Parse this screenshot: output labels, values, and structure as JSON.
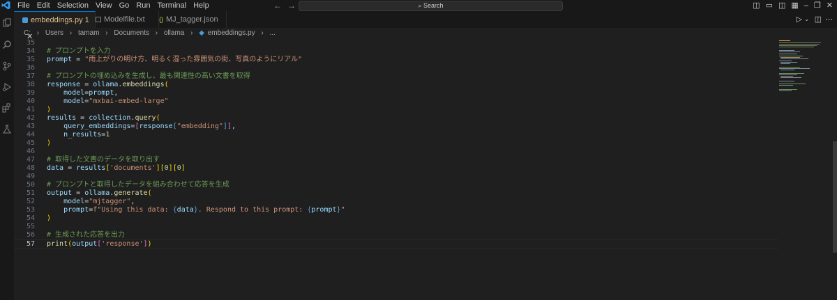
{
  "menu": [
    "File",
    "Edit",
    "Selection",
    "View",
    "Go",
    "Run",
    "Terminal",
    "Help"
  ],
  "search": {
    "label": "Search"
  },
  "tabs": [
    {
      "label": "embeddings.py 1",
      "icon": "python-icon"
    },
    {
      "label": "Modelfile.txt",
      "icon": "text-file-icon"
    },
    {
      "label": "MJ_tagger.json",
      "icon": "json-icon"
    }
  ],
  "breadcrumb": [
    "C:",
    "Users",
    "tamam",
    "Documents",
    "ollama",
    "embeddings.py",
    "..."
  ],
  "editor": {
    "lines": [
      {
        "n": "35",
        "parts": []
      },
      {
        "n": "34",
        "parts": [
          {
            "t": "# プロンプトを入力",
            "c": "c"
          }
        ]
      },
      {
        "n": "35",
        "parts": [
          {
            "t": "prompt",
            "c": "v"
          },
          {
            "t": " = ",
            "c": "o"
          },
          {
            "t": "\"雨上がりの明け方、明るく湿った雰囲気の街、写真のようにリアル\"",
            "c": "s"
          }
        ]
      },
      {
        "n": "36",
        "parts": []
      },
      {
        "n": "37",
        "parts": [
          {
            "t": "# プロンプトの埋め込みを生成し、最も関連性の高い文書を取得",
            "c": "c"
          }
        ]
      },
      {
        "n": "38",
        "parts": [
          {
            "t": "response",
            "c": "v"
          },
          {
            "t": " = ",
            "c": "o"
          },
          {
            "t": "ollama",
            "c": "v"
          },
          {
            "t": ".",
            "c": "o"
          },
          {
            "t": "embeddings",
            "c": "f"
          },
          {
            "t": "(",
            "c": "p"
          }
        ]
      },
      {
        "n": "39",
        "parts": [
          {
            "t": "    model",
            "c": "v"
          },
          {
            "t": "=",
            "c": "o"
          },
          {
            "t": "prompt",
            "c": "v"
          },
          {
            "t": ",",
            "c": "o"
          }
        ]
      },
      {
        "n": "40",
        "parts": [
          {
            "t": "    model",
            "c": "v"
          },
          {
            "t": "=",
            "c": "o"
          },
          {
            "t": "\"mxbai-embed-large\"",
            "c": "s"
          }
        ]
      },
      {
        "n": "41",
        "parts": [
          {
            "t": ")",
            "c": "p"
          }
        ]
      },
      {
        "n": "42",
        "parts": [
          {
            "t": "results",
            "c": "v"
          },
          {
            "t": " = ",
            "c": "o"
          },
          {
            "t": "collection",
            "c": "v"
          },
          {
            "t": ".",
            "c": "o"
          },
          {
            "t": "query",
            "c": "f"
          },
          {
            "t": "(",
            "c": "p"
          }
        ]
      },
      {
        "n": "43",
        "parts": [
          {
            "t": "    query_embeddings",
            "c": "v"
          },
          {
            "t": "=",
            "c": "o"
          },
          {
            "t": "[",
            "c": "p2"
          },
          {
            "t": "response",
            "c": "v"
          },
          {
            "t": "[",
            "c": "k"
          },
          {
            "t": "\"embedding\"",
            "c": "s"
          },
          {
            "t": "]",
            "c": "k"
          },
          {
            "t": "]",
            "c": "p2"
          },
          {
            "t": ",",
            "c": "o"
          }
        ]
      },
      {
        "n": "44",
        "parts": [
          {
            "t": "    n_results",
            "c": "v"
          },
          {
            "t": "=",
            "c": "o"
          },
          {
            "t": "1",
            "c": "n"
          }
        ]
      },
      {
        "n": "45",
        "parts": [
          {
            "t": ")",
            "c": "p"
          }
        ]
      },
      {
        "n": "46",
        "parts": []
      },
      {
        "n": "47",
        "parts": [
          {
            "t": "# 取得した文書のデータを取り出す",
            "c": "c"
          }
        ]
      },
      {
        "n": "48",
        "parts": [
          {
            "t": "data",
            "c": "v"
          },
          {
            "t": " = ",
            "c": "o"
          },
          {
            "t": "results",
            "c": "v"
          },
          {
            "t": "[",
            "c": "p"
          },
          {
            "t": "'documents'",
            "c": "s"
          },
          {
            "t": "]",
            "c": "p"
          },
          {
            "t": "[",
            "c": "p"
          },
          {
            "t": "0",
            "c": "n"
          },
          {
            "t": "]",
            "c": "p"
          },
          {
            "t": "[",
            "c": "p"
          },
          {
            "t": "0",
            "c": "n"
          },
          {
            "t": "]",
            "c": "p"
          }
        ]
      },
      {
        "n": "49",
        "parts": []
      },
      {
        "n": "50",
        "parts": [
          {
            "t": "# プロンプトと取得したデータを組み合わせて応答を生成",
            "c": "c"
          }
        ]
      },
      {
        "n": "51",
        "parts": [
          {
            "t": "output",
            "c": "v"
          },
          {
            "t": " = ",
            "c": "o"
          },
          {
            "t": "ollama",
            "c": "v"
          },
          {
            "t": ".",
            "c": "o"
          },
          {
            "t": "generate",
            "c": "f"
          },
          {
            "t": "(",
            "c": "p"
          }
        ]
      },
      {
        "n": "52",
        "parts": [
          {
            "t": "    model",
            "c": "v"
          },
          {
            "t": "=",
            "c": "o"
          },
          {
            "t": "\"mjtagger\"",
            "c": "s"
          },
          {
            "t": ",",
            "c": "o"
          }
        ]
      },
      {
        "n": "53",
        "parts": [
          {
            "t": "    prompt",
            "c": "v"
          },
          {
            "t": "=",
            "c": "o"
          },
          {
            "t": "f\"Using this data: ",
            "c": "s"
          },
          {
            "t": "{",
            "c": "k"
          },
          {
            "t": "data",
            "c": "v"
          },
          {
            "t": "}",
            "c": "k"
          },
          {
            "t": ". Respond to this prompt: ",
            "c": "s"
          },
          {
            "t": "{",
            "c": "k"
          },
          {
            "t": "prompt",
            "c": "v"
          },
          {
            "t": "}",
            "c": "k"
          },
          {
            "t": "\"",
            "c": "s"
          }
        ]
      },
      {
        "n": "54",
        "parts": [
          {
            "t": ")",
            "c": "p"
          }
        ]
      },
      {
        "n": "55",
        "parts": []
      },
      {
        "n": "56",
        "parts": [
          {
            "t": "# 生成された応答を出力",
            "c": "c"
          }
        ]
      },
      {
        "n": "57",
        "parts": [
          {
            "t": "print",
            "c": "f"
          },
          {
            "t": "(",
            "c": "p"
          },
          {
            "t": "output",
            "c": "v"
          },
          {
            "t": "[",
            "c": "p2"
          },
          {
            "t": "'response'",
            "c": "s"
          },
          {
            "t": "]",
            "c": "p2"
          },
          {
            "t": ")",
            "c": "p"
          }
        ],
        "current": true
      }
    ]
  },
  "colors": {
    "accent": "#0078d4",
    "modified_tab": "#e2c08d"
  }
}
